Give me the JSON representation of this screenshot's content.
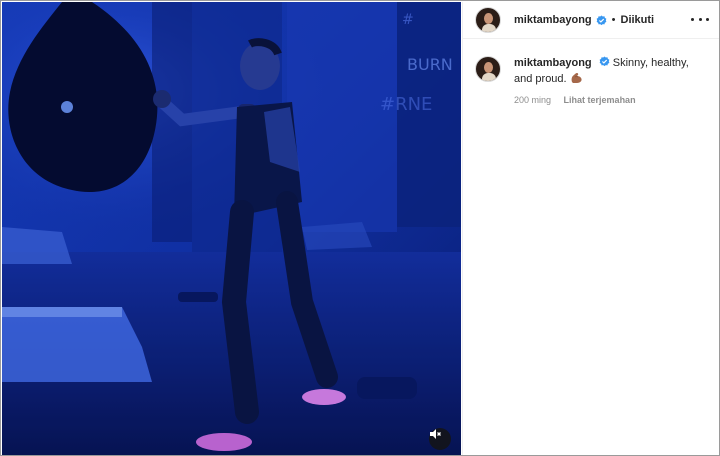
{
  "post": {
    "username": "miktambayong",
    "follow_state": "Diikuti",
    "separator": "•",
    "caption_username": "miktambayong",
    "caption_text": "Skinny, healthy, and proud.",
    "time_ago": "200 ming",
    "translate_label": "Lihat terjemahan"
  },
  "icons": {
    "verified": "verified-badge-icon",
    "more": "more-options-icon",
    "mute": "speaker-muted-icon",
    "emoji": "flexed-biceps-emoji"
  },
  "colors": {
    "verified_blue": "#3897f0",
    "video_blue": "#0f2a9a"
  }
}
